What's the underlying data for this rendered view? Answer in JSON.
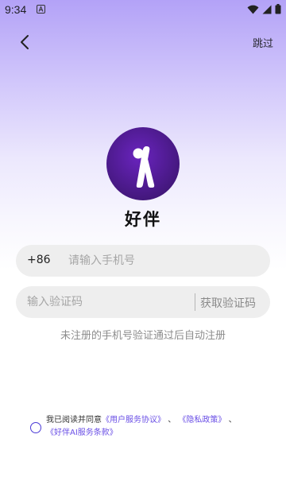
{
  "status_bar": {
    "time": "9:34",
    "app_icon": "a-square-icon",
    "icons": [
      "wifi-icon",
      "signal-icon",
      "battery-icon"
    ]
  },
  "header": {
    "back_icon": "chevron-left-icon",
    "skip_label": "跳过"
  },
  "brand": {
    "logo_icon": "app-logo-icon",
    "app_name": "好伴"
  },
  "phone": {
    "country_code": "+86",
    "placeholder": "请输入手机号",
    "value": ""
  },
  "code": {
    "placeholder": "输入验证码",
    "value": "",
    "get_code_label": "获取验证码"
  },
  "hint": "未注册的手机号验证通过后自动注册",
  "agreement": {
    "prefix": "我已阅读并同意",
    "user_agreement": "《用户服务协议》",
    "sep1": "、",
    "privacy_policy": "《隐私政策》",
    "sep2": "、",
    "ai_terms": "《好伴AI服务条款》",
    "checked": false
  },
  "colors": {
    "accent": "#6a4fe6",
    "logo_bg": "#4a1a8c",
    "gradient_top": "#b3a2f7"
  }
}
